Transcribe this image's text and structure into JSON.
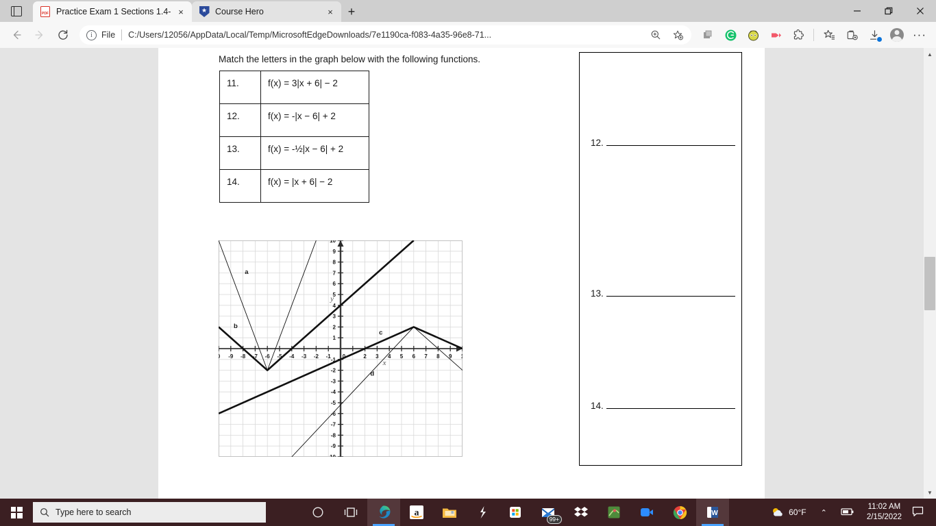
{
  "window": {
    "minimize_label": "Minimize",
    "restore_label": "Restore",
    "close_label": "Close"
  },
  "browser": {
    "tab_search_icon": "tab-search-icon",
    "tabs": [
      {
        "title": "Practice Exam 1 Sections 1.4-1.9",
        "favicon": "pdf-icon",
        "close_label": "×",
        "active": true
      },
      {
        "title": "Course Hero",
        "favicon": "shield-icon",
        "close_label": "×",
        "active": false
      }
    ],
    "new_tab_label": "+",
    "nav": {
      "back_label": "←",
      "forward_label": "→",
      "refresh_label": "⟳"
    },
    "omnibox": {
      "info_icon": "info-icon",
      "scheme_label": "File",
      "url": "C:/Users/12056/AppData/Local/Temp/MicrosoftEdgeDownloads/7e1190ca-f083-4a35-96e8-71...",
      "zoom_icon": "zoom-in-icon",
      "favorite_icon": "add-favorite-icon"
    },
    "toolbar_right": [
      {
        "name": "extension-generic-icon",
        "glyph": "◰"
      },
      {
        "name": "grammarly-extension-icon",
        "glyph": "G"
      },
      {
        "name": "honey-extension-icon",
        "glyph": "◎"
      },
      {
        "name": "media-extension-icon",
        "glyph": "▶"
      },
      {
        "name": "extensions-puzzle-icon",
        "glyph": "✦"
      },
      {
        "name": "favorites-icon",
        "glyph": "☆"
      },
      {
        "name": "collections-icon",
        "glyph": "⧉"
      },
      {
        "name": "downloads-icon",
        "glyph": "↓"
      },
      {
        "name": "profile-avatar-icon",
        "glyph": ""
      },
      {
        "name": "settings-more-icon",
        "glyph": "···"
      }
    ]
  },
  "document": {
    "prompt": "Match the letters in the graph below with the following functions.",
    "questions": [
      {
        "number": "11.",
        "function": "f(x) = 3|x + 6| − 2"
      },
      {
        "number": "12.",
        "function": "f(x) = -|x − 6| + 2"
      },
      {
        "number": "13.",
        "function": "f(x) = -½|x − 6| + 2"
      },
      {
        "number": "14.",
        "function": "f(x) = |x + 6| − 2"
      }
    ],
    "answer_box": {
      "rows": [
        {
          "number": "12.",
          "value": ""
        },
        {
          "number": "13.",
          "value": ""
        },
        {
          "number": "14.",
          "value": ""
        }
      ]
    },
    "scrollbar": {
      "up_arrow": "▲",
      "down_arrow": "▼"
    }
  },
  "chart_data": {
    "type": "line",
    "title": "",
    "xlabel": "x",
    "ylabel": "y",
    "xlim": [
      -10,
      10
    ],
    "ylim": [
      -10,
      10
    ],
    "grid": true,
    "xticks": [
      "0",
      "-9",
      "-8",
      "-7",
      "-6",
      "-5",
      "-4",
      "-3",
      "-2",
      "-1",
      "0",
      "2",
      "3",
      "4",
      "5",
      "6",
      "7",
      "8",
      "9",
      "1"
    ],
    "yticks": [
      "10",
      "9",
      "8",
      "7",
      "6",
      "5",
      "4",
      "3",
      "2",
      "1",
      "-1",
      "-2",
      "-3",
      "-4",
      "-5",
      "-6",
      "-7",
      "-8",
      "-9",
      "-10"
    ],
    "legend_position": "inline-labels",
    "series": [
      {
        "name": "a",
        "label": "a",
        "label_x": -7.7,
        "label_y": 6.9,
        "style": "thin",
        "description": "V-shape, vertex (-6,-2), slope 3",
        "points": [
          [
            -10,
            10
          ],
          [
            -6,
            -2
          ],
          [
            -2,
            10
          ]
        ]
      },
      {
        "name": "b",
        "label": "b",
        "label_x": -8.6,
        "label_y": 1.9,
        "style": "thick",
        "description": "V-shape, vertex (-6,-2), slope 1",
        "points": [
          [
            -10,
            2
          ],
          [
            -6,
            -2
          ],
          [
            4,
            8
          ],
          [
            6,
            10
          ]
        ]
      },
      {
        "name": "c",
        "label": "c",
        "label_x": 3.3,
        "label_y": 1.3,
        "style": "thick",
        "description": "Inverted V, vertex (6,2), slope -1/2",
        "points": [
          [
            -10,
            -6
          ],
          [
            6,
            2
          ],
          [
            10,
            0
          ]
        ]
      },
      {
        "name": "d",
        "label": "d",
        "label_x": 2.6,
        "label_y": -2.5,
        "style": "thin",
        "description": "Inverted V, vertex (6,2), slope -1",
        "points": [
          [
            -4,
            -10
          ],
          [
            6,
            2
          ],
          [
            10,
            -2
          ]
        ]
      }
    ]
  },
  "taskbar": {
    "start_label": "Start",
    "search_placeholder": "Type here to search",
    "search_icon": "search-icon",
    "icons": [
      {
        "name": "cortana-icon",
        "glyph": "O"
      },
      {
        "name": "task-view-icon",
        "glyph": "▤"
      },
      {
        "name": "microsoft-edge-icon",
        "glyph": "e",
        "active": true
      },
      {
        "name": "amazon-icon",
        "glyph": "a"
      },
      {
        "name": "file-explorer-icon",
        "glyph": "🗀"
      },
      {
        "name": "shazam-icon",
        "glyph": "S"
      },
      {
        "name": "microsoft-store-icon",
        "glyph": "▣"
      },
      {
        "name": "mail-icon",
        "glyph": "✉",
        "badge": "99+"
      },
      {
        "name": "dropbox-icon",
        "glyph": "❖"
      },
      {
        "name": "game-icon",
        "glyph": "■"
      },
      {
        "name": "zoom-icon",
        "glyph": "▶"
      },
      {
        "name": "google-chrome-icon",
        "glyph": "◉"
      },
      {
        "name": "microsoft-word-icon",
        "glyph": "W",
        "active": true
      }
    ],
    "tray": {
      "weather_icon": "weather-partly-cloudy-icon",
      "weather_temp": "60°F",
      "chevron_label": "⌃",
      "battery_icon": "battery-icon",
      "time": "11:02 AM",
      "date": "2/15/2022",
      "notification_icon": "notifications-icon"
    }
  },
  "colors": {
    "taskbar_bg": "#3b1f22",
    "tab_active_bg": "#f7f7f7",
    "accent_blue": "#0b73da",
    "page_bg": "#ffffff",
    "viewer_bg": "#e4e4e4"
  }
}
